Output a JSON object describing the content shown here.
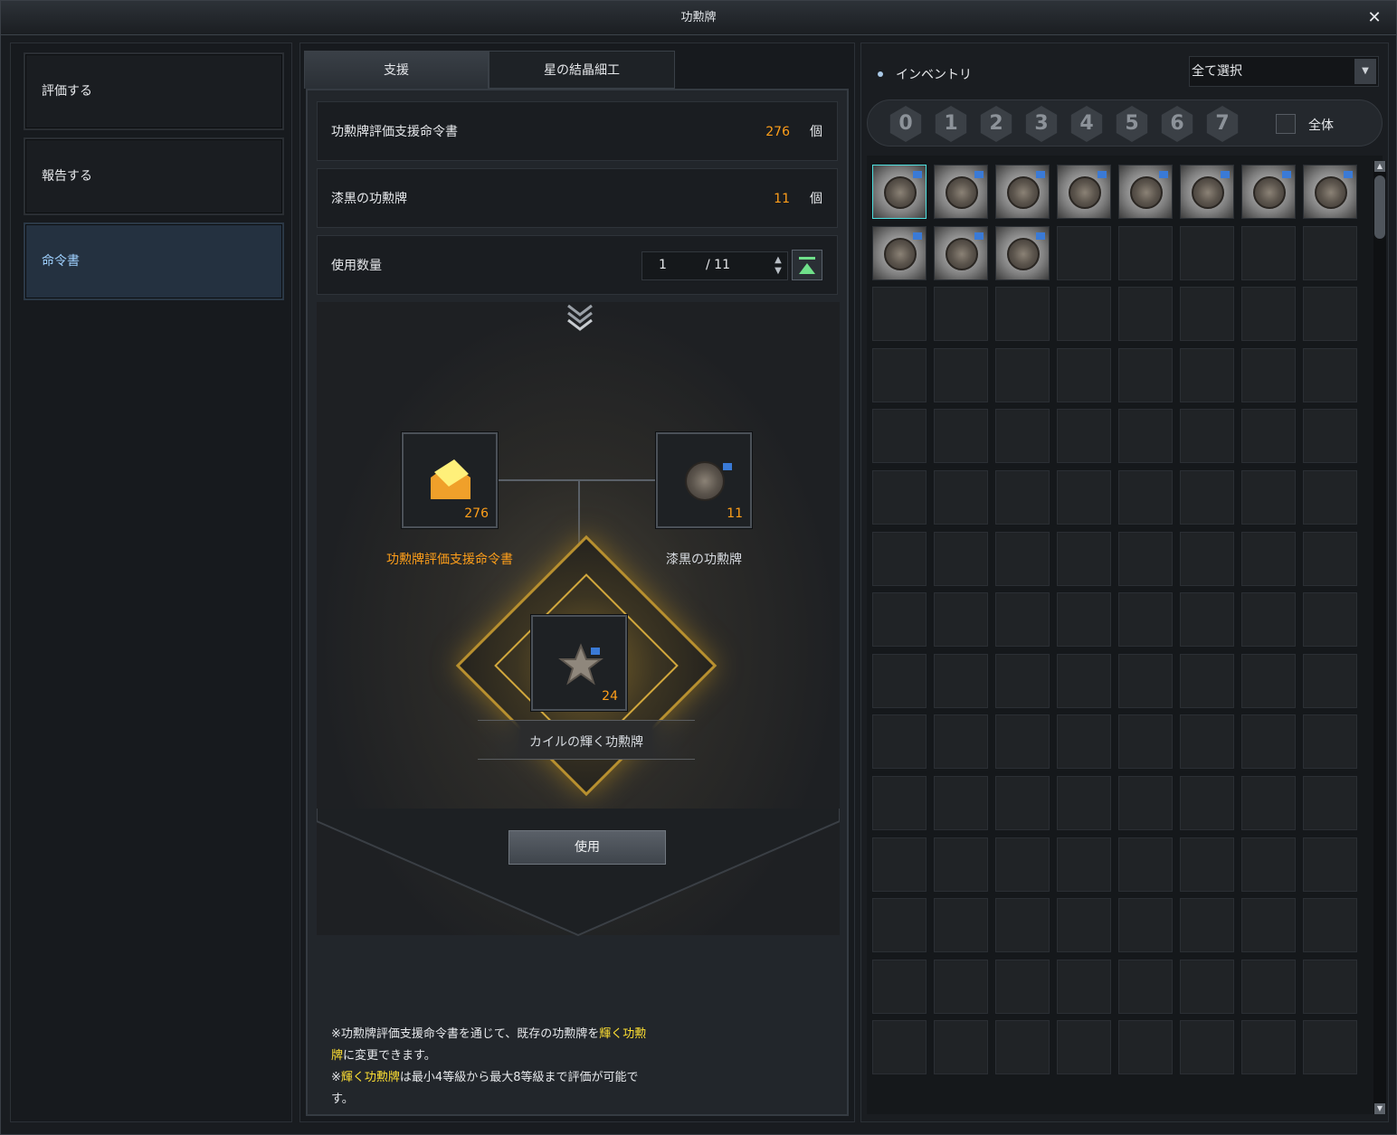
{
  "window": {
    "title": "功勲牌"
  },
  "left_nav": [
    "評価する",
    "報告する",
    "命令書"
  ],
  "tabs": [
    "支援",
    "星の結晶細工"
  ],
  "rows": {
    "order_name": "功勲牌評価支援命令書",
    "order_count": "276",
    "medal_name": "漆黒の功勲牌",
    "medal_count": "11",
    "unit": "個",
    "qty_label": "使用数量",
    "qty_value": "1",
    "qty_max": "/ 11"
  },
  "craft": {
    "input1_name": "功勲牌評価支援命令書",
    "input1_count": "276",
    "input2_name": "漆黒の功勲牌",
    "input2_count": "11",
    "result_name": "カイルの輝く功勲牌",
    "result_count": "24",
    "use_button": "使用"
  },
  "notes": {
    "line1_a": "※功勲牌評価支援命令書を通じて、既存の功勲牌を",
    "line1_hl": "輝く功勲牌",
    "line1_b": "に変更できます。",
    "line2_a": "※",
    "line2_hl": "輝く功勲牌",
    "line2_b": "は最小4等級から最大8等級まで評価が可能です。"
  },
  "inventory": {
    "title": "インベントリ",
    "select_value": "全て選択",
    "grades": [
      "0",
      "1",
      "2",
      "3",
      "4",
      "5",
      "6",
      "7"
    ],
    "all_label": "全体",
    "filled_slots": 11
  },
  "colors": {
    "orange": "#ff9f1a",
    "highlight": "#ffe033",
    "active_tab_text": "#9fd1ff"
  }
}
